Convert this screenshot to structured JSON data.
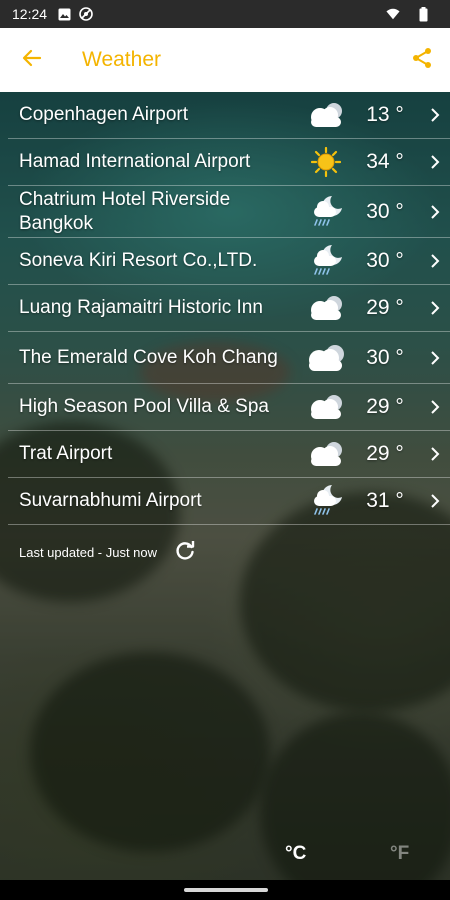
{
  "status_bar": {
    "time": "12:24",
    "icons": [
      "image-icon",
      "no-sim-icon",
      "wifi-icon",
      "battery-icon"
    ]
  },
  "app_bar": {
    "title": "Weather",
    "back_icon": "arrow-left-icon",
    "share_icon": "share-icon",
    "accent_color": "#f4b400"
  },
  "locations": [
    {
      "name": "Copenhagen Airport",
      "temp": "13 °",
      "icon": "cloudy-icon"
    },
    {
      "name": "Hamad International Airport",
      "temp": "34 °",
      "icon": "sunny-icon"
    },
    {
      "name": "Chatrium Hotel Riverside Bangkok",
      "temp": "30 °",
      "icon": "night-rain-icon"
    },
    {
      "name": "Soneva Kiri Resort Co.,LTD.",
      "temp": "30 °",
      "icon": "night-rain-icon"
    },
    {
      "name": "Luang Rajamaitri Historic Inn",
      "temp": "29 °",
      "icon": "cloudy-icon"
    },
    {
      "name": "The Emerald Cove Koh Chang",
      "temp": "30 °",
      "icon": "cloudy-icon"
    },
    {
      "name": "High Season Pool Villa & Spa",
      "temp": "29 °",
      "icon": "cloudy-icon"
    },
    {
      "name": "Trat Airport",
      "temp": "29 °",
      "icon": "cloudy-icon"
    },
    {
      "name": "Suvarnabhumi Airport",
      "temp": "31 °",
      "icon": "night-rain-icon"
    }
  ],
  "footer": {
    "last_updated": "Last updated - Just now",
    "refresh_icon": "refresh-icon"
  },
  "units": {
    "celsius": "°C",
    "fahrenheit": "°F",
    "selected": "celsius"
  }
}
